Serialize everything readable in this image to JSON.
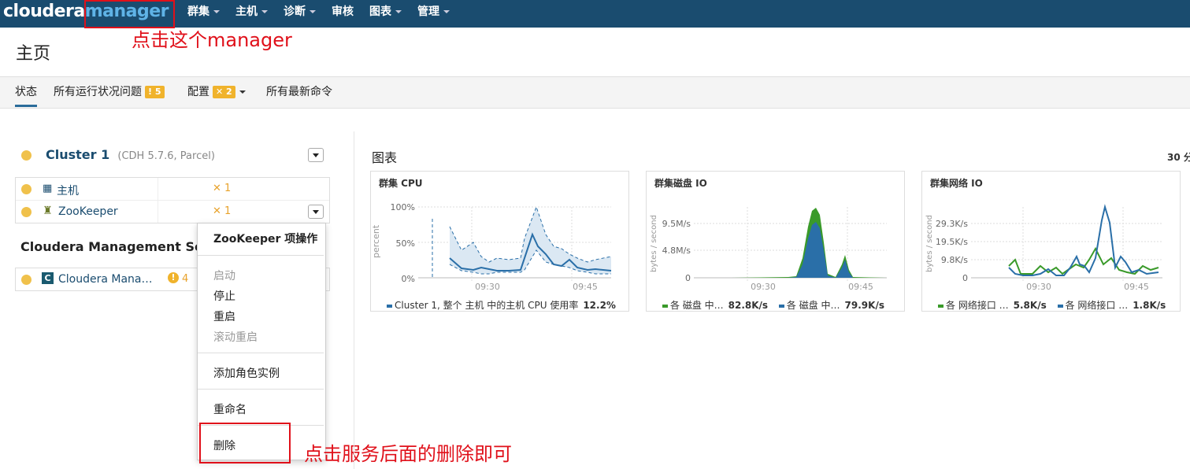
{
  "header": {
    "logo_left": "cloudera",
    "logo_right": "manager",
    "nav": [
      "群集",
      "主机",
      "诊断",
      "审核",
      "图表",
      "管理"
    ]
  },
  "annotations": {
    "manager_hint": "点击这个manager",
    "delete_hint": "点击服务后面的删除即可"
  },
  "page_title": "主页",
  "tabs": {
    "status": "状态",
    "health_issues": "所有运行状况问题",
    "health_issues_count": "5",
    "config": "配置",
    "config_count": "2",
    "commands": "所有最新命令"
  },
  "cluster": {
    "name": "Cluster 1",
    "version": "(CDH 5.7.6, Parcel)",
    "rows": [
      {
        "icon": "hosts-icon",
        "label": "主机",
        "config_count": "1"
      },
      {
        "icon": "zookeeper-icon",
        "label": "ZooKeeper",
        "config_count": "1"
      }
    ]
  },
  "mgmt": {
    "title": "Cloudera Management Ser",
    "row_label": "Cloudera Mana…",
    "row_count": "4"
  },
  "menu": {
    "header": "ZooKeeper 项操作",
    "start": "启动",
    "stop": "停止",
    "restart": "重启",
    "rolling_restart": "滚动重启",
    "add_role": "添加角色实例",
    "rename": "重命名",
    "delete": "删除"
  },
  "charts": {
    "section_title": "图表",
    "time_range": "30 分",
    "x_ticks": [
      "09:30",
      "09:45"
    ],
    "cards": [
      {
        "title": "群集 CPU",
        "ylabel": "percent",
        "y_ticks": [
          "100%",
          "50%",
          "0%"
        ],
        "legend": [
          {
            "label": "Cluster 1, 整个 主机 中的主机 CPU 使用率",
            "value": "12.2%",
            "color": "#2a6fa8"
          }
        ]
      },
      {
        "title": "群集磁盘 IO",
        "ylabel": "bytes / second",
        "y_ticks": [
          "9.5M/s",
          "4.8M/s",
          "0"
        ],
        "legend": [
          {
            "label": "各 磁盘 中…",
            "value": "82.8K/s",
            "color": "#3a9a2a"
          },
          {
            "label": "各 磁盘 中…",
            "value": "79.9K/s",
            "color": "#2a6fa8"
          }
        ]
      },
      {
        "title": "群集网络 IO",
        "ylabel": "bytes / second",
        "y_ticks": [
          "29.3K/s",
          "19.5K/s",
          "9.8K/s",
          "0"
        ],
        "legend": [
          {
            "label": "各 网络接口 …",
            "value": "5.8K/s",
            "color": "#3a9a2a"
          },
          {
            "label": "各 网络接口 …",
            "value": "1.8K/s",
            "color": "#2a6fa8"
          }
        ]
      }
    ]
  },
  "colors": {
    "topbar": "#1a4c6f",
    "accent": "#2a6c9a",
    "warning": "#f0b32c",
    "annotation": "#e0101a"
  }
}
